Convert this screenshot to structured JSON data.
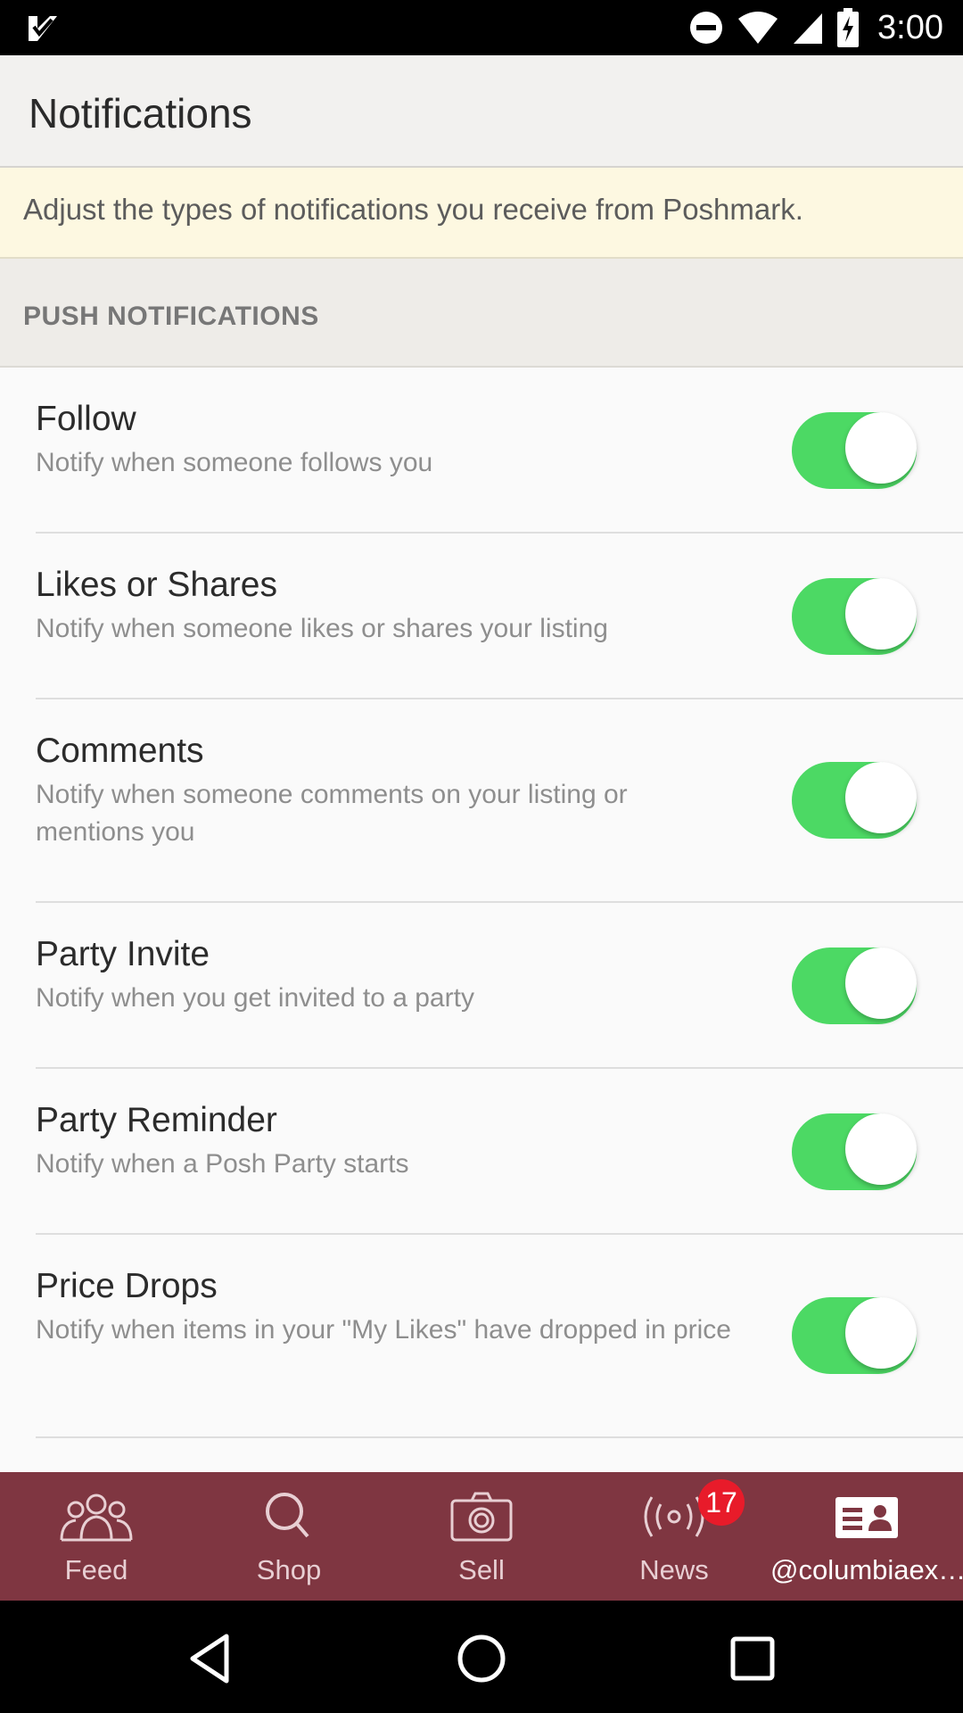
{
  "status_bar": {
    "time": "3:00",
    "icons": [
      "check-logo-icon",
      "dnd-icon",
      "wifi-icon",
      "cell-signal-icon",
      "battery-charging-icon"
    ]
  },
  "header": {
    "title": "Notifications"
  },
  "banner": {
    "text": "Adjust the types of notifications you receive from Poshmark."
  },
  "section": {
    "title": "PUSH NOTIFICATIONS"
  },
  "settings": [
    {
      "label": "Follow",
      "description": "Notify when someone follows you",
      "enabled": true
    },
    {
      "label": "Likes or Shares",
      "description": "Notify when someone likes or shares your listing",
      "enabled": true
    },
    {
      "label": "Comments",
      "description": "Notify when someone comments on your listing or mentions you",
      "enabled": true
    },
    {
      "label": "Party Invite",
      "description": "Notify when you get invited to a party",
      "enabled": true
    },
    {
      "label": "Party Reminder",
      "description": "Notify when a Posh Party starts",
      "enabled": true
    },
    {
      "label": "Price Drops",
      "description": "Notify when items in your \"My Likes\" have dropped in price",
      "enabled": true
    }
  ],
  "bottom_nav": {
    "items": [
      {
        "label": "Feed",
        "icon": "people-icon"
      },
      {
        "label": "Shop",
        "icon": "search-icon"
      },
      {
        "label": "Sell",
        "icon": "camera-icon"
      },
      {
        "label": "News",
        "icon": "broadcast-icon"
      },
      {
        "label": "@columbiaex…",
        "icon": "profile-card-icon"
      }
    ],
    "news_badge": "17"
  },
  "colors": {
    "nav_bg": "#7f3641",
    "toggle_on": "#4cd964",
    "badge": "#e81b2a",
    "banner_bg": "#fdf8e1"
  }
}
